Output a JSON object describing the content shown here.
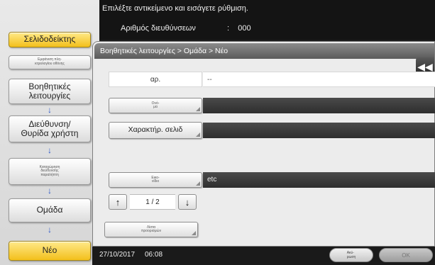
{
  "header": {
    "message": "Επιλέξτε αντικείμενο και εισάγετε ρύθμιση.",
    "address_label": "Αριθμός διευθύνσεων",
    "address_sep": ":",
    "address_count": "000"
  },
  "sidebar": {
    "bookmark": "Σελιδοδείκτης",
    "display_keypad": "Εμφάνιση πλη-\nκτρολογίου οθόνης",
    "steps": [
      "Βοηθητικές\nλειτουργίες",
      "Διεύθυνση/\nΘυρίδα χρήστη",
      "Καταχώρηση\nδιεύθυνσης\nπαραλήπτη",
      "Ομάδα",
      "Νέο"
    ],
    "arrow": "↓"
  },
  "panel": {
    "breadcrumb": "Βοηθητικές λειτουργίες > Ομάδα > Νέο",
    "collapse_icon": "◀◀",
    "fields": {
      "number_label": "αρ.",
      "number_value": "--",
      "name_label": "Ονό-\nμα",
      "name_value": "",
      "index_label": "Χαρακτήρ. σελιδ",
      "index_value": "",
      "icon_label": "Εικο-\nνίδιο",
      "icon_value": "etc"
    },
    "pager": {
      "up": "↑",
      "current": "1",
      "sep": "/",
      "total": "2",
      "down": "↓"
    },
    "dest_list": "Λίστα\nπροορισμών"
  },
  "footer": {
    "date": "27/10/2017",
    "time": "06:08",
    "cancel": "Ακύ-\nρωση",
    "ok": "ΟΚ"
  }
}
